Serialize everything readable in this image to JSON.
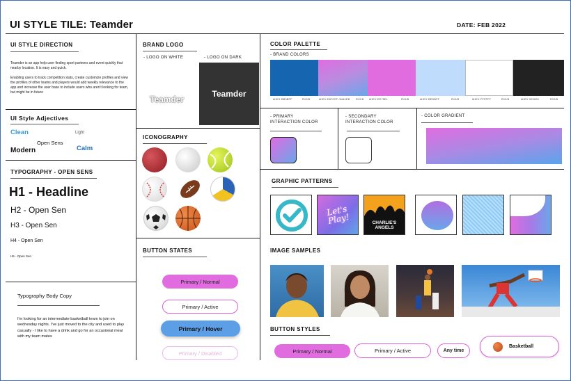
{
  "header": {
    "title": "UI STYLE TILE: Teamder",
    "date": "DATE: FEB 2022"
  },
  "direction": {
    "heading": "UI STYLE DIRECTION",
    "p1": "Teamder is an app help user finding sport partners and event quickly that nearby location.  It is easy and quick.",
    "p2": "Enabling users to track competition stats, create customize profiles and view the profiles of other teams and players would add weekly relevance to the app and increase the user base to include users who aren't looking for team, but might be in future"
  },
  "adjectives": {
    "heading": "UI Style Adjectives",
    "clean": "Clean",
    "light": "Light",
    "open_sens": "Open Sens",
    "modern": "Modern",
    "calm": "Calm"
  },
  "typography": {
    "heading": "TYPOGRAPHY - OPEN SENS",
    "h1": "H1 - Headline",
    "h2": "H2 - Open Sen",
    "h3": "H3 - Open Sen",
    "h4": "H4 - Open Sen",
    "h5": "H5 - Open Sen",
    "body_heading": "Typography Body Copy",
    "body": "I'm looking for an intermediate basketball team to join on wednesday nights. I've just moved to the city and used to play casually - I like to have a drink and go for an occasional meal with my team mates"
  },
  "brand": {
    "heading": "BRAND LOGO",
    "on_white": "- LOGO ON WHITE",
    "on_dark": "- LOGO ON DARK",
    "logo_text": "Teamder"
  },
  "iconography": {
    "heading": "ICONOGRAPHY",
    "icons": [
      "cricket-ball-icon",
      "golf-ball-icon",
      "tennis-ball-icon",
      "baseball-icon",
      "football-icon",
      "volleyball-icon",
      "soccer-ball-icon",
      "basketball-icon"
    ]
  },
  "button_states": {
    "heading": "BUTTON STATES",
    "normal": "Primary / Normal",
    "active": "Primary / Active",
    "hover": "Primary / Hover",
    "disabled": "Primary / Disabled"
  },
  "palette": {
    "heading": "COLOR PALETTE",
    "brand_colors": "- BRAND COLORS",
    "swatches": [
      {
        "color": "#1565b0",
        "hex": "#HEX  BB0BFF",
        "rgb": "R/G/B"
      },
      {
        "color": "#d76cdd",
        "hex": "#HEX E870CF /6444EB",
        "rgb": "R/G/B"
      },
      {
        "color": "#e06ce0",
        "hex": "#HEX  EE75E1",
        "rgb": "R/G/B"
      },
      {
        "color": "#bfdcfc",
        "hex": "#HEX  BEDBFF",
        "rgb": "R/G/B"
      },
      {
        "color": "#ffffff",
        "hex": "#HEX  FFFFFF",
        "rgb": "R/G/B"
      },
      {
        "color": "#222222",
        "hex": "#HEX  000000",
        "rgb": "R/G/B"
      }
    ],
    "primary": "- PRIMARY\nINTERACTION COLOR",
    "secondary": "- SECONDARY\nINTERACTION COLOR",
    "gradient": "- COLOR GRADIENT"
  },
  "patterns": {
    "heading": "GRAPHIC PATTERNS",
    "lets_play": "Let's Play!",
    "charlies": "CHARLIE'S ANGELS"
  },
  "images": {
    "heading": "IMAGE SAMPLES"
  },
  "button_styles": {
    "heading": "BUTTON STYLES",
    "normal": "Primary / Normal",
    "active": "Primary / Active",
    "anytime": "Any time",
    "basketball": "Basketball"
  }
}
